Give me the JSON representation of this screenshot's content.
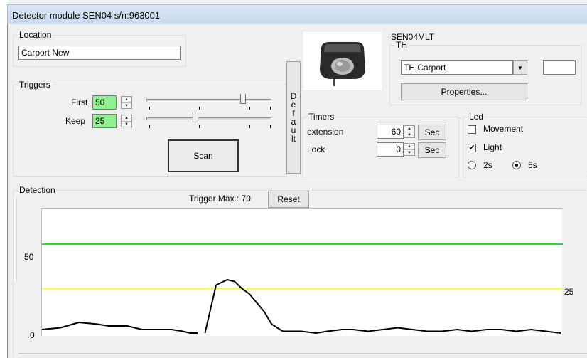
{
  "window": {
    "title": "Detector module SEN04 s/n:963001"
  },
  "location": {
    "legend": "Location",
    "value": "Carport New"
  },
  "device": {
    "model": "SEN04MLT"
  },
  "th": {
    "legend": "TH",
    "selected": "TH Carport",
    "extra_value": "",
    "properties_label": "Properties..."
  },
  "triggers": {
    "legend": "Triggers",
    "first_label": "First",
    "first_value": "50",
    "keep_label": "Keep",
    "keep_value": "25",
    "scan_label": "Scan",
    "default_label": "Default"
  },
  "timers": {
    "legend": "Timers",
    "extension_label": "extension",
    "extension_value": "60",
    "extension_unit": "Sec",
    "lock_label": "Lock",
    "lock_value": "0",
    "lock_unit": "Sec"
  },
  "led": {
    "legend": "Led",
    "movement_label": "Movement",
    "movement_checked": false,
    "light_label": "Light",
    "light_checked": true,
    "option_2s": "2s",
    "option_5s": "5s",
    "selected_option": "5s"
  },
  "detection": {
    "legend": "Detection",
    "trigger_max_label": "Trigger Max.: 70",
    "reset_label": "Reset",
    "y_max": 70,
    "first_level": 50,
    "keep_level": 25,
    "label_50": "50",
    "label_0": "0",
    "label_25": "25",
    "trace_segments": [
      [
        [
          0,
          2
        ],
        [
          5,
          3
        ],
        [
          10,
          6
        ],
        [
          15,
          5
        ],
        [
          18,
          4
        ],
        [
          23,
          4
        ],
        [
          27,
          2
        ],
        [
          30,
          2
        ],
        [
          35,
          2
        ],
        [
          38,
          1
        ],
        [
          40,
          0
        ],
        [
          42,
          0
        ]
      ],
      [
        [
          44,
          0
        ],
        [
          47,
          27
        ],
        [
          49,
          29
        ],
        [
          50,
          30
        ],
        [
          52,
          29
        ],
        [
          54,
          25
        ],
        [
          56,
          22
        ],
        [
          60,
          12
        ],
        [
          62,
          5
        ],
        [
          65,
          1
        ],
        [
          70,
          1
        ],
        [
          74,
          0
        ],
        [
          77,
          1
        ],
        [
          81,
          2
        ],
        [
          84,
          2
        ],
        [
          88,
          1
        ],
        [
          92,
          2
        ],
        [
          96,
          3
        ],
        [
          100,
          2
        ],
        [
          104,
          1
        ],
        [
          108,
          1
        ],
        [
          112,
          2
        ],
        [
          116,
          1
        ],
        [
          120,
          2
        ],
        [
          124,
          2
        ],
        [
          128,
          1
        ],
        [
          132,
          2
        ],
        [
          136,
          1
        ],
        [
          140,
          0
        ]
      ]
    ],
    "trace_color": "#000000",
    "first_color": "#22dd22",
    "keep_color": "#ffff22"
  }
}
